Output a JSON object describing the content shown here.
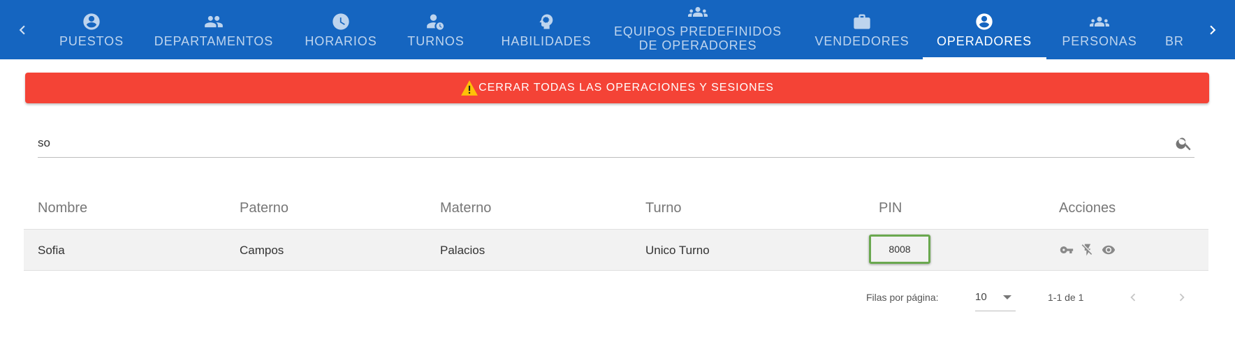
{
  "nav": {
    "prev_icon": "chevron-left-icon",
    "next_icon": "chevron-right-icon",
    "tabs": [
      {
        "label": "PUESTOS",
        "icon": "account-circle-icon"
      },
      {
        "label": "DEPARTAMENTOS",
        "icon": "people-icon"
      },
      {
        "label": "HORARIOS",
        "icon": "clock-icon"
      },
      {
        "label": "TURNOS",
        "icon": "user-clock-icon"
      },
      {
        "label": "HABILIDADES",
        "icon": "brain-icon"
      },
      {
        "label": "EQUIPOS PREDEFINIDOS DE OPERADORES",
        "icon": "groups-icon"
      },
      {
        "label": "VENDEDORES",
        "icon": "briefcase-icon"
      },
      {
        "label": "OPERADORES",
        "icon": "account-circle-icon",
        "active": true
      },
      {
        "label": "PERSONAS",
        "icon": "groups-icon"
      },
      {
        "label": "BR",
        "icon": ""
      }
    ],
    "colors": {
      "bar": "#1565c0",
      "active_text": "#ffffff",
      "inactive_text": "rgba(255,255,255,0.72)"
    }
  },
  "alert": {
    "label": "CERRAR TODAS LAS OPERACIONES Y SESIONES",
    "icon": "warning-icon",
    "color": "#f44336"
  },
  "search": {
    "value": "so",
    "icon": "search-icon"
  },
  "table": {
    "columns": [
      "Nombre",
      "Paterno",
      "Materno",
      "Turno",
      "PIN",
      "Acciones"
    ],
    "rows": [
      {
        "nombre": "Sofia",
        "paterno": "Campos",
        "materno": "Palacios",
        "turno": "Unico Turno",
        "pin": "8008",
        "actions": [
          "key-icon",
          "no-flash-icon",
          "eye-icon"
        ]
      }
    ],
    "highlight_color": "#6aa84f"
  },
  "pagination": {
    "rows_per_page_label": "Filas por página:",
    "rows_per_page": "10",
    "range": "1-1 de 1",
    "prev_icon": "chevron-left-icon",
    "next_icon": "chevron-right-icon"
  }
}
